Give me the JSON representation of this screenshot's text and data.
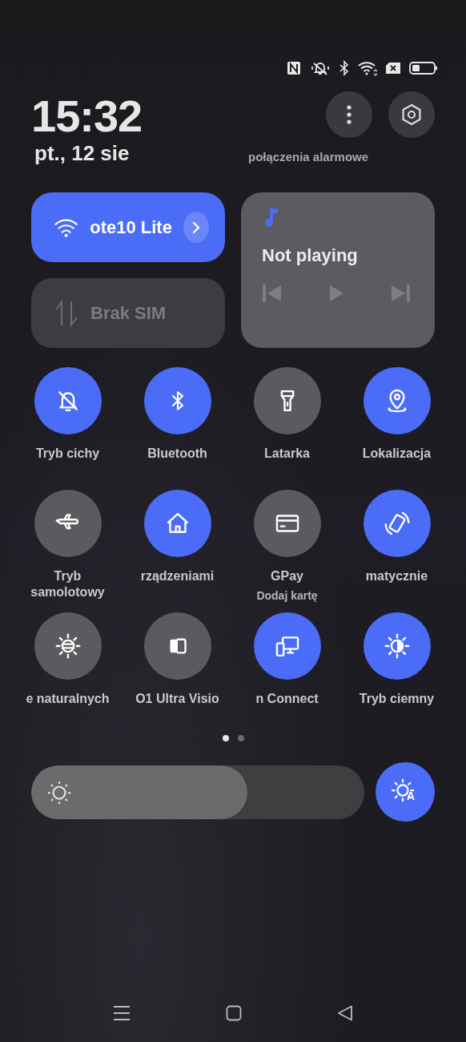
{
  "clock": {
    "time": "15:32",
    "date": "pt., 12 sie"
  },
  "emergency_text": "połączenia alarmowe",
  "wifi_tile": {
    "label": "ote10 Lite",
    "on": true
  },
  "data_tile": {
    "label": "Brak SIM",
    "disabled": true
  },
  "media": {
    "title": "Not playing"
  },
  "toggles": [
    {
      "label": "Tryb cichy",
      "on": true
    },
    {
      "label": "Bluetooth",
      "on": true
    },
    {
      "label": "Latarka",
      "on": false
    },
    {
      "label": "Lokalizacja",
      "on": true
    },
    {
      "label": "Tryb samolotowy",
      "on": false
    },
    {
      "label": "rządzeniami",
      "on": true
    },
    {
      "label": "GPay",
      "sublabel": "Dodaj kartę",
      "on": false
    },
    {
      "label": "matycznie",
      "on": true
    },
    {
      "label": "e naturalnych",
      "on": false
    },
    {
      "label": "O1 Ultra Visio",
      "on": false
    },
    {
      "label": "n Connect",
      "on": true
    },
    {
      "label": "Tryb ciemny",
      "on": true
    }
  ],
  "pages": [
    {
      "selected": true
    },
    {
      "selected": false
    }
  ],
  "brightness": {
    "level": 0.65
  },
  "auto_brightness": {
    "on": true,
    "badge": "A"
  }
}
